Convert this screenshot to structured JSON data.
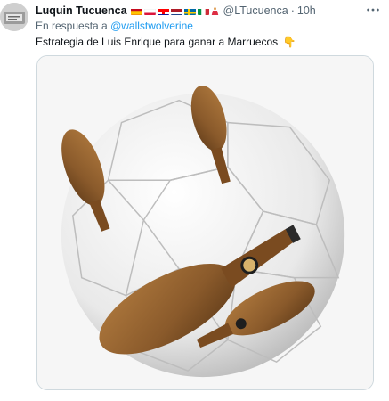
{
  "tweet": {
    "author_name": "Luquin Tucuenca",
    "flags": [
      "spain-flag",
      "poland-flag",
      "croatia-flag",
      "netherlands-flag",
      "sweden-flag",
      "italy-flag",
      "dancer-emoji"
    ],
    "handle": "@LTucuenca",
    "separator": "·",
    "time": "10h",
    "more_icon": "ellipsis-icon",
    "reply_prefix": "En respuesta a",
    "reply_handle": "@wallstwolverine",
    "text": "Estrategia de Luis Enrique para ganar a Marruecos",
    "text_emoji": "👇",
    "media": {
      "description": "soccer-ball-with-iberian-ham-legs",
      "hams": 4
    }
  },
  "colors": {
    "link": "#1d9bf0",
    "secondary_text": "#536471",
    "primary_text": "#0f1419",
    "ham": "#8a5a2b"
  }
}
